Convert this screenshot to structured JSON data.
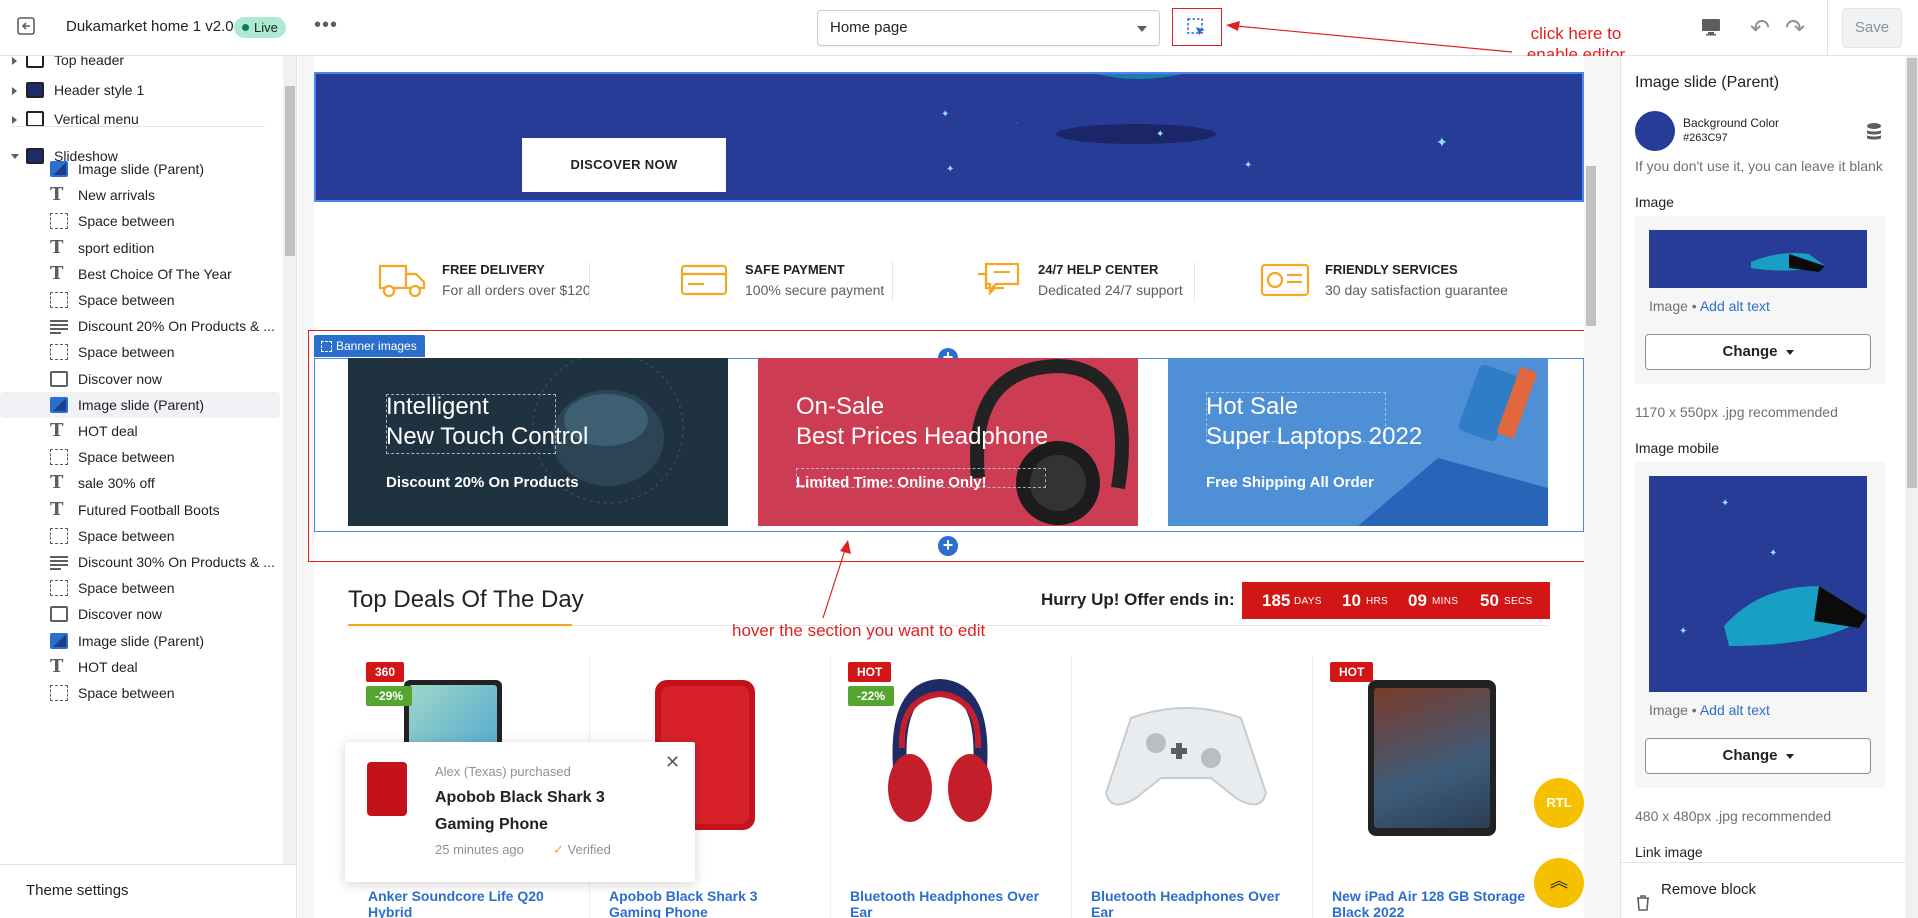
{
  "topbar": {
    "store_title": "Dukamarket home 1 v2.0",
    "status": "Live",
    "template_select": "Home page",
    "save_label": "Save"
  },
  "annotations": {
    "enable_editor": "click here to enable editor",
    "hover_section": "hover the section you want to edit"
  },
  "sidebar": {
    "sections": [
      {
        "label": "Top header"
      },
      {
        "label": "Header style 1"
      },
      {
        "label": "Vertical menu"
      },
      {
        "label": "Slideshow"
      }
    ],
    "blocks": [
      {
        "type": "image",
        "label": "Image slide (Parent)"
      },
      {
        "type": "text",
        "label": "New arrivals"
      },
      {
        "type": "space",
        "label": "Space between"
      },
      {
        "type": "text",
        "label": "sport edition"
      },
      {
        "type": "text",
        "label": "Best Choice Of The Year"
      },
      {
        "type": "space",
        "label": "Space between"
      },
      {
        "type": "paragraph",
        "label": "Discount 20% On Products & ..."
      },
      {
        "type": "space",
        "label": "Space between"
      },
      {
        "type": "button",
        "label": "Discover now"
      },
      {
        "type": "image",
        "label": "Image slide (Parent)"
      },
      {
        "type": "text",
        "label": "HOT deal"
      },
      {
        "type": "space",
        "label": "Space between"
      },
      {
        "type": "text",
        "label": "sale 30% off"
      },
      {
        "type": "text",
        "label": "Futured Football Boots"
      },
      {
        "type": "space",
        "label": "Space between"
      },
      {
        "type": "paragraph",
        "label": "Discount 30% On Products & ..."
      },
      {
        "type": "space",
        "label": "Space between"
      },
      {
        "type": "button",
        "label": "Discover now"
      },
      {
        "type": "image",
        "label": "Image slide (Parent)"
      },
      {
        "type": "text",
        "label": "HOT deal"
      },
      {
        "type": "space",
        "label": "Space between"
      }
    ],
    "footer": "Theme settings"
  },
  "preview": {
    "hero_button": "DISCOVER NOW",
    "features": [
      {
        "icon": "truck-icon",
        "title": "FREE DELIVERY",
        "sub": "For all orders over $120"
      },
      {
        "icon": "card-icon",
        "title": "SAFE PAYMENT",
        "sub": "100% secure payment"
      },
      {
        "icon": "chat-icon",
        "title": "24/7 HELP CENTER",
        "sub": "Dedicated 24/7 support"
      },
      {
        "icon": "id-card-icon",
        "title": "FRIENDLY SERVICES",
        "sub": "30 day satisfaction guarantee"
      }
    ],
    "banner_tag": "Banner images",
    "banners": [
      {
        "title1": "Intelligent",
        "title2": "New Touch Control",
        "sub": "Discount 20% On Products",
        "color": "#1f3240"
      },
      {
        "title1": "On-Sale",
        "title2": "Best Prices Headphone",
        "sub": "Limited Time: Online Only!",
        "color": "#cc3c52"
      },
      {
        "title1": "Hot Sale",
        "title2": "Super Laptops 2022",
        "sub": "Free Shipping All Order",
        "color": "#4e8fd6"
      }
    ],
    "deals_title": "Top Deals Of The Day",
    "hurry": "Hurry Up! Offer ends in:",
    "timer": {
      "days": "185",
      "days_unit": "DAYS",
      "hrs": "10",
      "hrs_unit": "HRS",
      "mins": "09",
      "mins_unit": "MINS",
      "secs": "50",
      "secs_unit": "SECS"
    },
    "products": [
      {
        "badge1": "360",
        "badge2": "-29%",
        "name": "Anker Soundcore Life Q20 Hybrid"
      },
      {
        "badge1": "",
        "badge2": "",
        "name": "Apobob Black Shark 3 Gaming Phone"
      },
      {
        "badge1": "HOT",
        "badge2": "-22%",
        "name": "Bluetooth Headphones Over Ear"
      },
      {
        "badge1": "",
        "badge2": "",
        "name": "Bluetooth Headphones Over Ear"
      },
      {
        "badge1": "HOT",
        "badge2": "",
        "name": "New iPad Air 128 GB Storage Black 2022"
      }
    ],
    "rtl_label": "RTL",
    "popup": {
      "buyer": "Alex (Texas) purchased",
      "product": "Apobob Black Shark 3 Gaming Phone",
      "time": "25 minutes ago",
      "verified": "Verified"
    }
  },
  "settings": {
    "title": "Image slide (Parent)",
    "bg_label": "Background Color",
    "bg_value": "#263C97",
    "bg_help": "If you don't use it, you can leave it blank",
    "image_label": "Image",
    "image_link_prefix": "Image • ",
    "add_alt": "Add alt text",
    "change": "Change",
    "image_note": "1170 x 550px .jpg recommended",
    "mobile_label": "Image mobile",
    "mobile_note": "480 x 480px .jpg recommended",
    "link_label": "Link image",
    "remove": "Remove block"
  }
}
